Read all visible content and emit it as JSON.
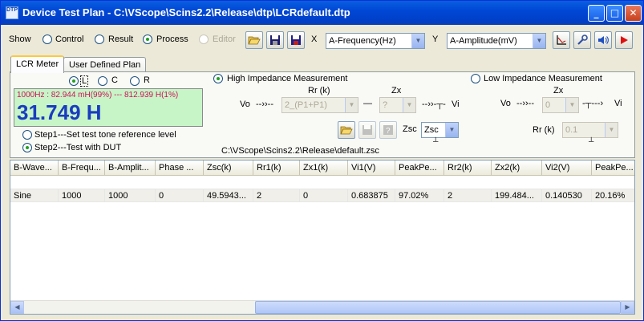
{
  "window": {
    "title": "Device Test Plan - C:\\VScope\\Scins2.2\\Release\\dtp\\LCRdefault.dtp",
    "icon_text": "DTP"
  },
  "toolbar": {
    "show_label": "Show",
    "modes": [
      "Control",
      "Result",
      "Process",
      "Editor"
    ],
    "selected_mode": "Process",
    "x_label": "X",
    "x_axis": "A-Frequency(Hz)",
    "y_label": "Y",
    "y_axis": "A-Amplitude(mV)"
  },
  "tabs": [
    "LCR Meter",
    "User Defined Plan"
  ],
  "lcr": {
    "type_options": [
      "L",
      "C",
      "R"
    ],
    "selected_type": "L",
    "reading_detail": "1000Hz : 82.944 mH(99%) --- 812.939 H(1%)",
    "reading_value": "31.749 H",
    "steps": [
      "Step1---Set test tone reference level",
      "Step2---Test with DUT"
    ],
    "selected_step": "Step2---Test with DUT"
  },
  "high_imp": {
    "label": "High Impedance Measurement",
    "rr_label": "Rr (k)",
    "zx_label": "Zx",
    "vo_label": "Vo",
    "vi_label": "Vi",
    "rr_value": "2_(P1+P1)",
    "zx_value": "?",
    "zsc_label": "Zsc",
    "zsc_value": "Zsc",
    "file_path": "C:\\VScope\\Scins2.2\\Release\\default.zsc"
  },
  "low_imp": {
    "label": "Low Impedance Measurement",
    "zx_label": "Zx",
    "vo_label": "Vo",
    "vi_label": "Vi",
    "zx_value": "0",
    "rr_label": "Rr (k)",
    "rr_value": "0.1"
  },
  "grid": {
    "columns": [
      "B-Wave...",
      "B-Frequ...",
      "B-Amplit...",
      "Phase ...",
      "Zsc(k)",
      "Rr1(k)",
      "Zx1(k)",
      "Vi1(V)",
      "PeakPe...",
      "Rr2(k)",
      "Zx2(k)",
      "Vi2(V)",
      "PeakPe..."
    ],
    "rows": [
      [
        "Sine",
        "1000",
        "1000",
        "0",
        "49.5943...",
        "2",
        "0",
        "0.683875",
        "97.02%",
        "2",
        "199.484...",
        "0.140530",
        "20.16%"
      ]
    ]
  }
}
